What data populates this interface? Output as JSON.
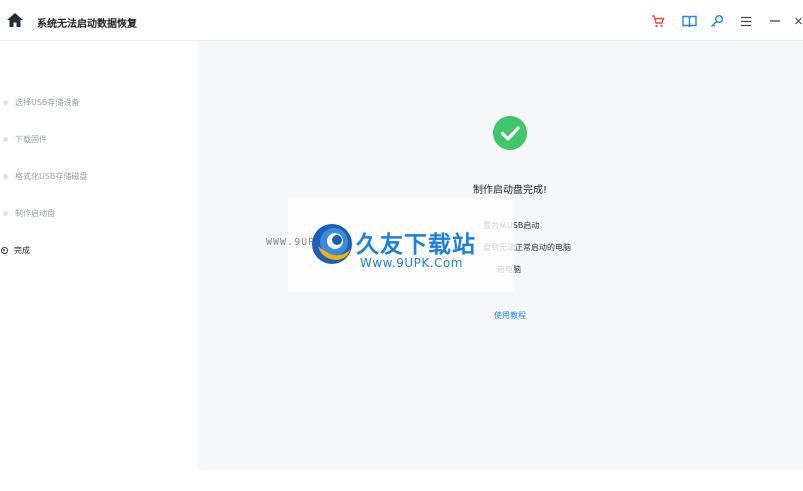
{
  "app": {
    "title": "系统无法启动数据恢复"
  },
  "toolbar": {
    "icons": [
      "cart-icon",
      "book-icon",
      "key-icon",
      "menu-icon",
      "minimize-icon",
      "close-icon"
    ],
    "accent": "#e74c3c",
    "icon_color": "#1e87e8"
  },
  "steps": [
    {
      "label": "选择USB存储设备",
      "state": "inactive"
    },
    {
      "label": "下载固件",
      "state": "inactive"
    },
    {
      "label": "格式化USB存储磁盘",
      "state": "inactive"
    },
    {
      "label": "制作启动盘",
      "state": "inactive"
    },
    {
      "label": "完成",
      "state": "active"
    }
  ],
  "main": {
    "done_title": "制作启动盘完成!",
    "lines": [
      "置为从USB启动",
      "盘到无法正常启动的电脑",
      "启电脑"
    ],
    "tutorial_link": "使用教程",
    "success_color": "#3fc76a"
  },
  "watermark": {
    "url_left": "WWW.9UPK.COM",
    "brand": "久友下载站",
    "url": "Www.9UPK.Com"
  }
}
